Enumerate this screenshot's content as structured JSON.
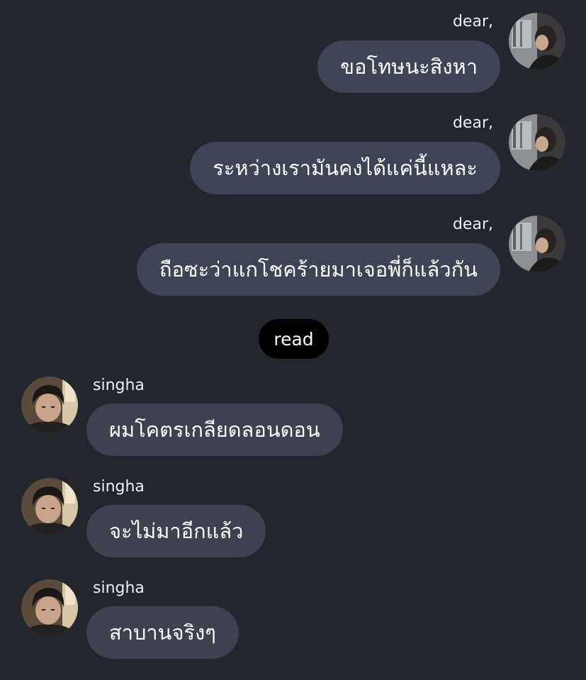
{
  "messages": [
    {
      "sender": "dear,",
      "text": "ขอโทษนะสิงหา",
      "direction": "out"
    },
    {
      "sender": "dear,",
      "text": "ระหว่างเรามันคงได้แค่นี้แหละ",
      "direction": "out"
    },
    {
      "sender": "dear,",
      "text": "ถือซะว่าแกโชคร้ายมาเจอพี่ก็แล้วกัน",
      "direction": "out"
    },
    {
      "sender": "singha",
      "text": "ผมโคตรเกลียดลอนดอน",
      "direction": "in"
    },
    {
      "sender": "singha",
      "text": "จะไม่มาอีกแล้ว",
      "direction": "in"
    },
    {
      "sender": "singha",
      "text": "สาบานจริงๆ",
      "direction": "in"
    }
  ],
  "read_status": "read",
  "colors": {
    "background": "#23262d",
    "outgoing_bubble": "#3d4455",
    "incoming_bubble": "#3e4150",
    "read_pill": "#000000"
  }
}
